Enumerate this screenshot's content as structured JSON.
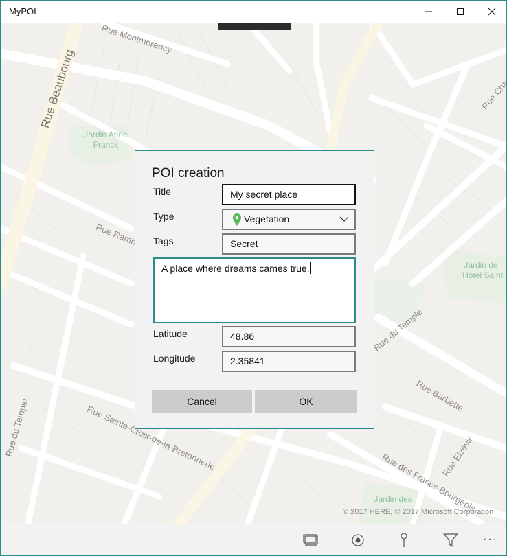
{
  "window": {
    "title": "MyPOI"
  },
  "map": {
    "streets": [
      "Rue Beaubourg",
      "Rue Montmorency",
      "Rue Rambuteau",
      "Rue du Temple",
      "Rue du Temple",
      "Rue Sainte-Croix-de-la-Bretonnerie",
      "Rue Barbette",
      "Rue des Francs-Bourgeois",
      "Rue Elzévir",
      "Rue Charlot"
    ],
    "parks": [
      "Jardin Anne Franck",
      "Jardin de l'Hôtel Saint",
      "Jardin des"
    ],
    "copyright": "© 2017 HERE, © 2017 Microsoft Corporation"
  },
  "dialog": {
    "title": "POI creation",
    "title_label": "Title",
    "title_value": "My secret place",
    "type_label": "Type",
    "type_value": "Vegetation",
    "tags_label": "Tags",
    "tags_value": "Secret",
    "description_value": "A place where dreams cames true.",
    "latitude_label": "Latitude",
    "latitude_value": "48.86",
    "longitude_label": "Longitude",
    "longitude_value": "2.35841",
    "cancel_label": "Cancel",
    "ok_label": "OK"
  },
  "appbar": {
    "icons": [
      "map-layers-icon",
      "location-target-icon",
      "pin-icon",
      "filter-icon",
      "more-icon"
    ],
    "more_label": "···"
  },
  "colors": {
    "accent": "#2b8a8a",
    "pin": "#5cb85c",
    "map_bg": "#f2f0ed",
    "road": "#ffffff",
    "major_road": "#fbf6e3"
  }
}
